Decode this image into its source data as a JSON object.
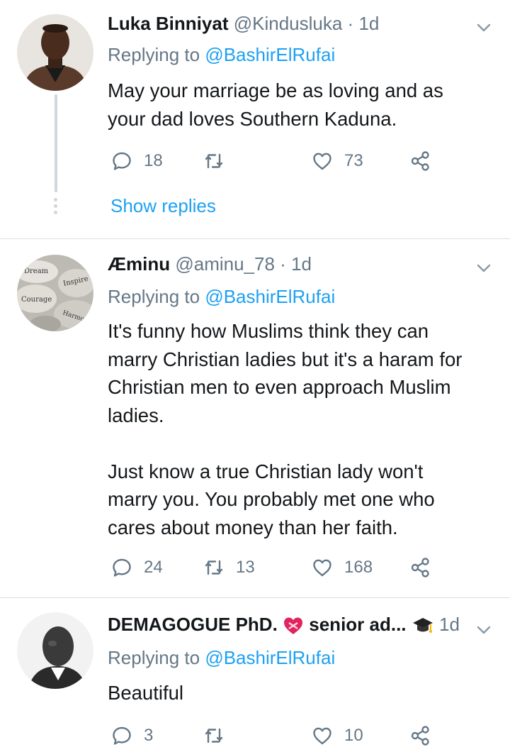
{
  "tweets": [
    {
      "name": "Luka Binniyat",
      "handle": "@Kindusluka",
      "separator": "·",
      "time": "1d",
      "replying_label": "Replying to",
      "replying_to": "@BashirElRufai",
      "text": "May your marriage be as loving and as\nyour dad loves Southern Kaduna.",
      "replies": "18",
      "retweets": "",
      "likes": "73",
      "show_replies": "Show replies",
      "avatar_icon": "user-photo"
    },
    {
      "name": "Æminu",
      "handle": "@aminu_78",
      "separator": "·",
      "time": "1d",
      "replying_label": "Replying to",
      "replying_to": "@BashirElRufai",
      "text": "It's funny how Muslims think they can\nmarry Christian ladies but it's a haram for\nChristian men to even approach Muslim\nladies.\n\nJust know a true Christian lady won't\nmarry you. You probably met one who\ncares about money than her faith.",
      "replies": "24",
      "retweets": "13",
      "likes": "168",
      "avatar_words": [
        "Dream",
        "Inspire",
        "Courage",
        "Harmony"
      ]
    },
    {
      "name": "DEMAGOGUE PhD.",
      "name_suffix": "senior ad...",
      "name_emojis": [
        "heart-with-ribbon-icon",
        "graduation-cap-icon"
      ],
      "separator": "",
      "time": "1d",
      "replying_label": "Replying to",
      "replying_to": "@BashirElRufai",
      "text": "Beautiful",
      "replies": "3",
      "retweets": "",
      "likes": "10",
      "avatar_icon": "user-photo"
    }
  ],
  "colors": {
    "link": "#1da1f2",
    "secondary": "#657786",
    "text": "#14171a",
    "divider": "#d9dfe3",
    "thread_line": "#cfd6dc"
  }
}
